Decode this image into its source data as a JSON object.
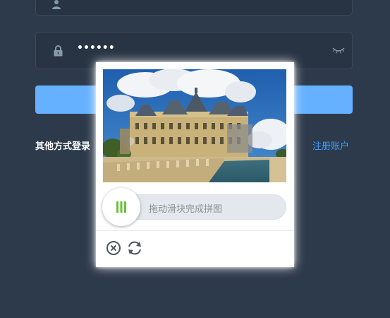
{
  "login": {
    "password_mask": "••••••",
    "other_login_label": "其他方式登录",
    "register_label": "注册账户"
  },
  "captcha": {
    "slider_hint": "拖动滑块完成拼图"
  },
  "colors": {
    "background": "#2d3a4b",
    "input_bg": "#283443",
    "primary_button": "#66b1ff",
    "link": "#409eff",
    "slider_bars": "#67c23a"
  },
  "icons": {
    "user": "user-icon",
    "lock": "lock-icon",
    "eye": "eye-closed-icon",
    "close": "close-icon",
    "refresh": "refresh-icon",
    "slider": "slider-bars-icon"
  }
}
